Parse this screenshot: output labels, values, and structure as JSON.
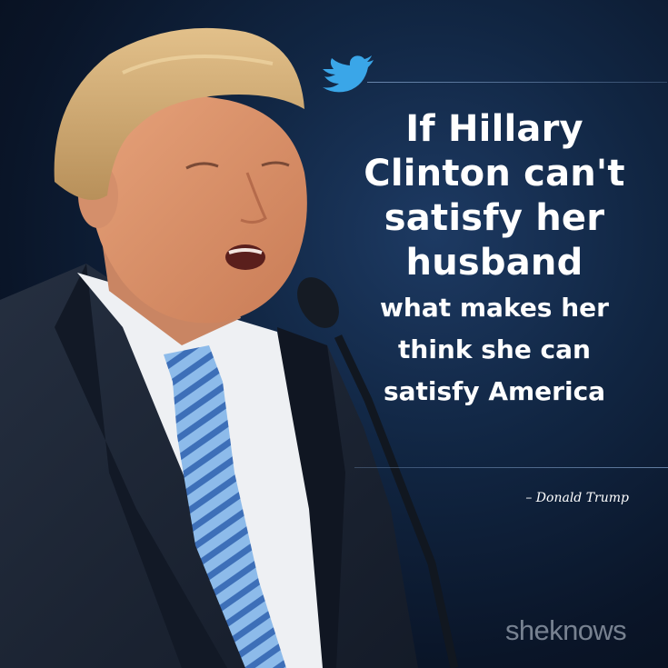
{
  "quote": {
    "line1": "If Hillary",
    "line2": "Clinton can't",
    "line3": "satisfy her",
    "line4": "husband",
    "line5": "what makes her",
    "line6": "think she can",
    "line7": "satisfy America"
  },
  "attribution": "– Donald Trump",
  "brand": "sheknows",
  "icons": {
    "bird": "twitter-bird-icon"
  },
  "colors": {
    "background": "#0b1526",
    "text": "#ffffff",
    "bird": "#3aa6e8",
    "tie": "#7fb0e6",
    "suit": "#1b2433"
  }
}
